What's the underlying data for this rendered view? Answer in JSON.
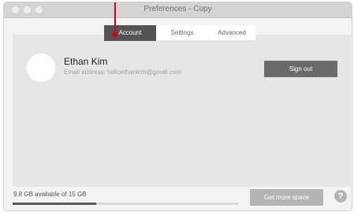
{
  "window": {
    "title": "Preferences - Copy"
  },
  "tabs": [
    {
      "label": "Account"
    },
    {
      "label": "Settings"
    },
    {
      "label": "Advanced"
    }
  ],
  "account": {
    "name": "Ethan Kim",
    "email_text": "Email address: helloethankim@gmail.com",
    "signout_label": "Sign out"
  },
  "storage": {
    "status_text": "9.8 GB available of 15 GB",
    "available_gb": 9.8,
    "total_gb": 15,
    "bar_fill_fraction": 0.37,
    "get_more_label": "Get more space"
  },
  "help": {
    "label": "?"
  },
  "colors": {
    "active_tab": "#555555",
    "signout_button": "#6a6a6a",
    "get_more_button": "#b4b4b4",
    "marker": "#d0021b"
  }
}
